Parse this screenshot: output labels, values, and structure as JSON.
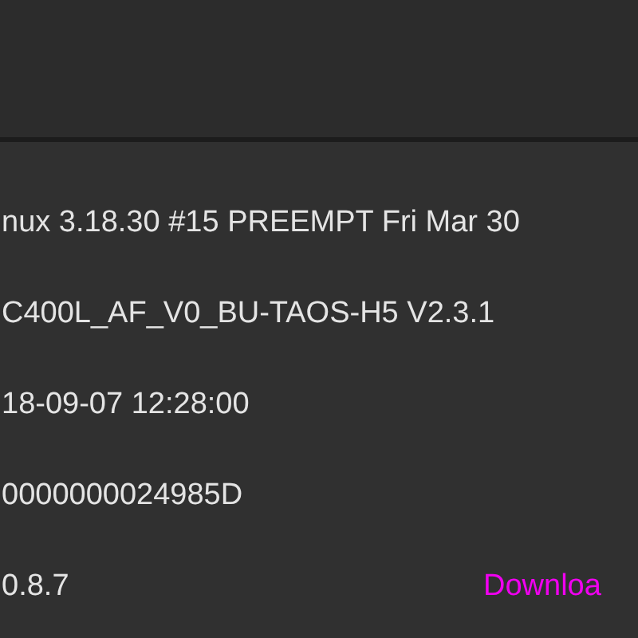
{
  "info_rows": [
    {
      "value": "nux 3.18.30 #15 PREEMPT Fri Mar 30"
    },
    {
      "value": "C400L_AF_V0_BU-TAOS-H5 V2.3.1"
    },
    {
      "value": "18-09-07 12:28:00"
    },
    {
      "value": "0000000024985D"
    },
    {
      "value": "0.8.7",
      "link": "Downloa"
    }
  ]
}
